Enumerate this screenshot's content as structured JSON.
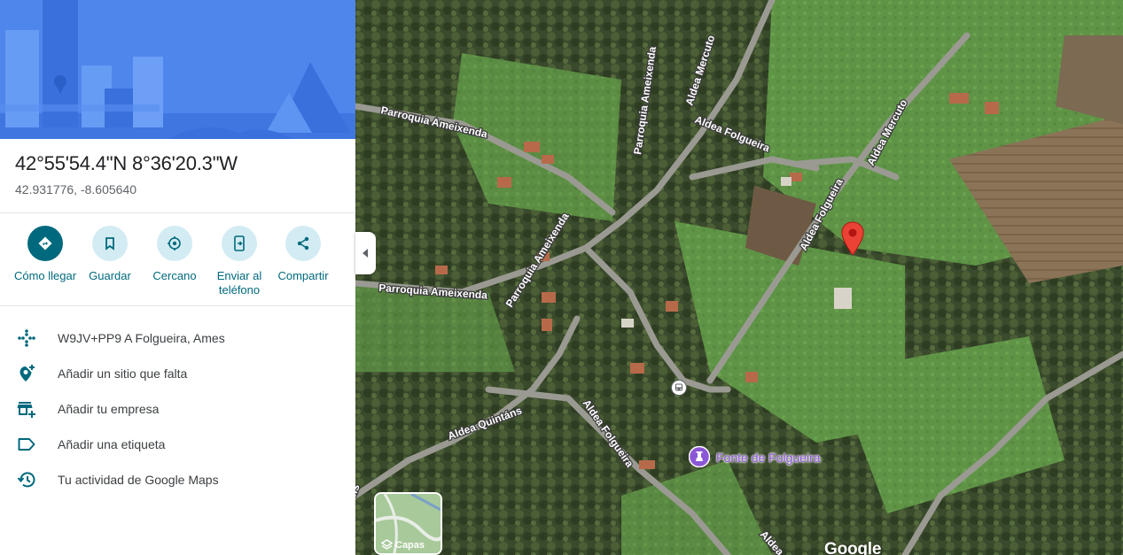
{
  "place": {
    "title": "42°55'54.4\"N 8°36'20.3\"W",
    "decimal": "42.931776, -8.605640"
  },
  "actions": [
    {
      "label": "Cómo llegar",
      "icon": "directions-icon"
    },
    {
      "label": "Guardar",
      "icon": "bookmark-icon"
    },
    {
      "label": "Cercano",
      "icon": "nearby-icon"
    },
    {
      "label": "Enviar al teléfono",
      "icon": "send-to-phone-icon"
    },
    {
      "label": "Compartir",
      "icon": "share-icon"
    }
  ],
  "details": [
    {
      "text": "W9JV+PP9 A Folgueira, Ames",
      "icon": "plus-code-icon"
    },
    {
      "text": "Añadir un sitio que falta",
      "icon": "add-place-icon"
    },
    {
      "text": "Añadir tu empresa",
      "icon": "add-business-icon"
    },
    {
      "text": "Añadir una etiqueta",
      "icon": "label-icon"
    },
    {
      "text": "Tu actividad de Google Maps",
      "icon": "history-icon"
    }
  ],
  "map": {
    "roads": [
      "Parroquia Ameixenda",
      "Parroquia Ameixenda",
      "Parroquia Ameixenda",
      "Parroquia Ameixenda",
      "Aldea Mercuto",
      "Aldea Mercuto",
      "Aldea Folgueira",
      "Aldea Folgueira",
      "Aldea Folgueira",
      "Aldea Quintáns",
      "Aldea",
      "ns"
    ],
    "poi": "Fonte de Folgueira",
    "layers_label": "Capas",
    "logo": "Google"
  },
  "colors": {
    "accent": "#00697d",
    "action_bg": "#d3ecf3",
    "pin": "#ea4335",
    "poi": "#8c57d6"
  }
}
